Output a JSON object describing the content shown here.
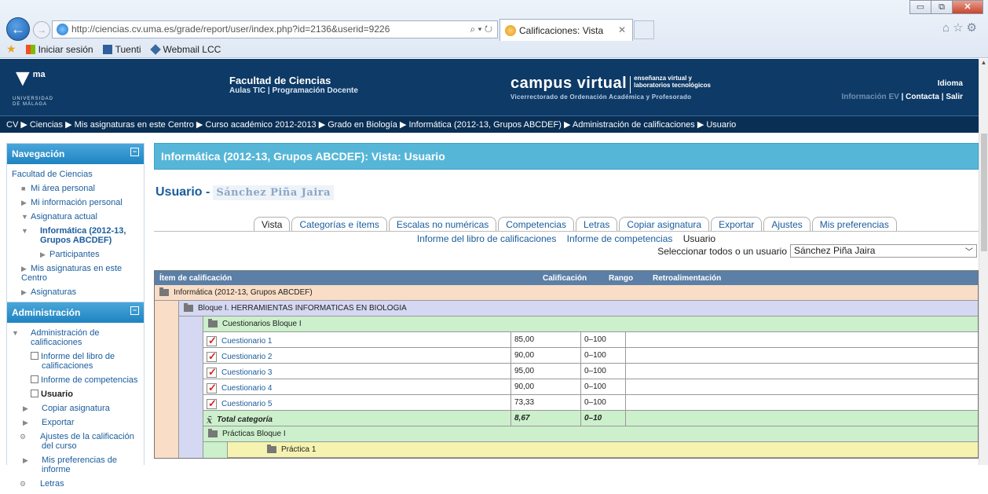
{
  "browser": {
    "url": "http://ciencias.cv.uma.es/grade/report/user/index.php?id=2136&userid=9226",
    "tab_title": "Calificaciones: Vista",
    "favorites": [
      "Iniciar sesión",
      "Tuenti",
      "Webmail LCC"
    ]
  },
  "header": {
    "logo": "ma",
    "logo_sub1": "UNIVERSIDAD",
    "logo_sub2": "DE MÁLAGA",
    "faculty": "Facultad de Ciencias",
    "faculty_sub": "Aulas TIC  |  Programación Docente",
    "campus": "campus virtual",
    "campus_sub1": "enseñanza virtual y",
    "campus_sub2": "laboratorios tecnológicos",
    "campus_line2": "Vicerrectorado de Ordenación Académica y Profesorado",
    "idioma": "Idioma",
    "info": "Información EV",
    "contacta": "Contacta",
    "salir": "Salir"
  },
  "breadcrumb": "CV ▶ Ciencias ▶ Mis asignaturas en este Centro ▶ Curso académico 2012-2013 ▶ Grado en Biología ▶ Informática (2012-13, Grupos ABCDEF) ▶ Administración de calificaciones ▶ Usuario",
  "navigation": {
    "title": "Navegación",
    "home": "Facultad de Ciencias",
    "items": [
      "Mi área personal",
      "Mi información personal",
      "Asignatura actual",
      "Informática (2012-13, Grupos ABCDEF)",
      "Participantes",
      "Mis asignaturas en este Centro",
      "Asignaturas"
    ]
  },
  "admin": {
    "title": "Administración",
    "items": [
      "Administración de calificaciones",
      "Informe del libro de calificaciones",
      "Informe de competencias",
      "Usuario",
      "Copiar asignatura",
      "Exportar",
      "Ajustes de la calificación del curso",
      "Mis preferencias de informe",
      "Letras"
    ]
  },
  "main": {
    "page_title": "Informática (2012-13, Grupos ABCDEF): Vista: Usuario",
    "user_label": "Usuario -",
    "user_name": "Sánchez Piña Jaira",
    "tabs": [
      "Vista",
      "Categorías e ítems",
      "Escalas no numéricas",
      "Competencias",
      "Letras",
      "Copiar asignatura",
      "Exportar",
      "Ajustes",
      "Mis preferencias"
    ],
    "subtabs": [
      "Informe del libro de calificaciones",
      "Informe de competencias",
      "Usuario"
    ],
    "select_label": "Seleccionar todos o un usuario",
    "select_value": "Sánchez Piña Jaira"
  },
  "grades": {
    "headers": {
      "item": "Ítem de calificación",
      "grade": "Calificación",
      "range": "Rango",
      "feedback": "Retroalimentación"
    },
    "course": "Informática (2012-13, Grupos ABCDEF)",
    "block": "Bloque I. HERRAMIENTAS INFORMATICAS EN BIOLOGIA",
    "cat1": "Cuestionarios Bloque I",
    "items": [
      {
        "name": "Cuestionario 1",
        "grade": "85,00",
        "range": "0–100"
      },
      {
        "name": "Cuestionario 2",
        "grade": "90,00",
        "range": "0–100"
      },
      {
        "name": "Cuestionario 3",
        "grade": "95,00",
        "range": "0–100"
      },
      {
        "name": "Cuestionario 4",
        "grade": "90,00",
        "range": "0–100"
      },
      {
        "name": "Cuestionario 5",
        "grade": "73,33",
        "range": "0–100"
      }
    ],
    "total": {
      "name": "Total categoría",
      "grade": "8,67",
      "range": "0–10"
    },
    "cat2": "Prácticas Bloque I",
    "cat3": "Práctica 1"
  }
}
